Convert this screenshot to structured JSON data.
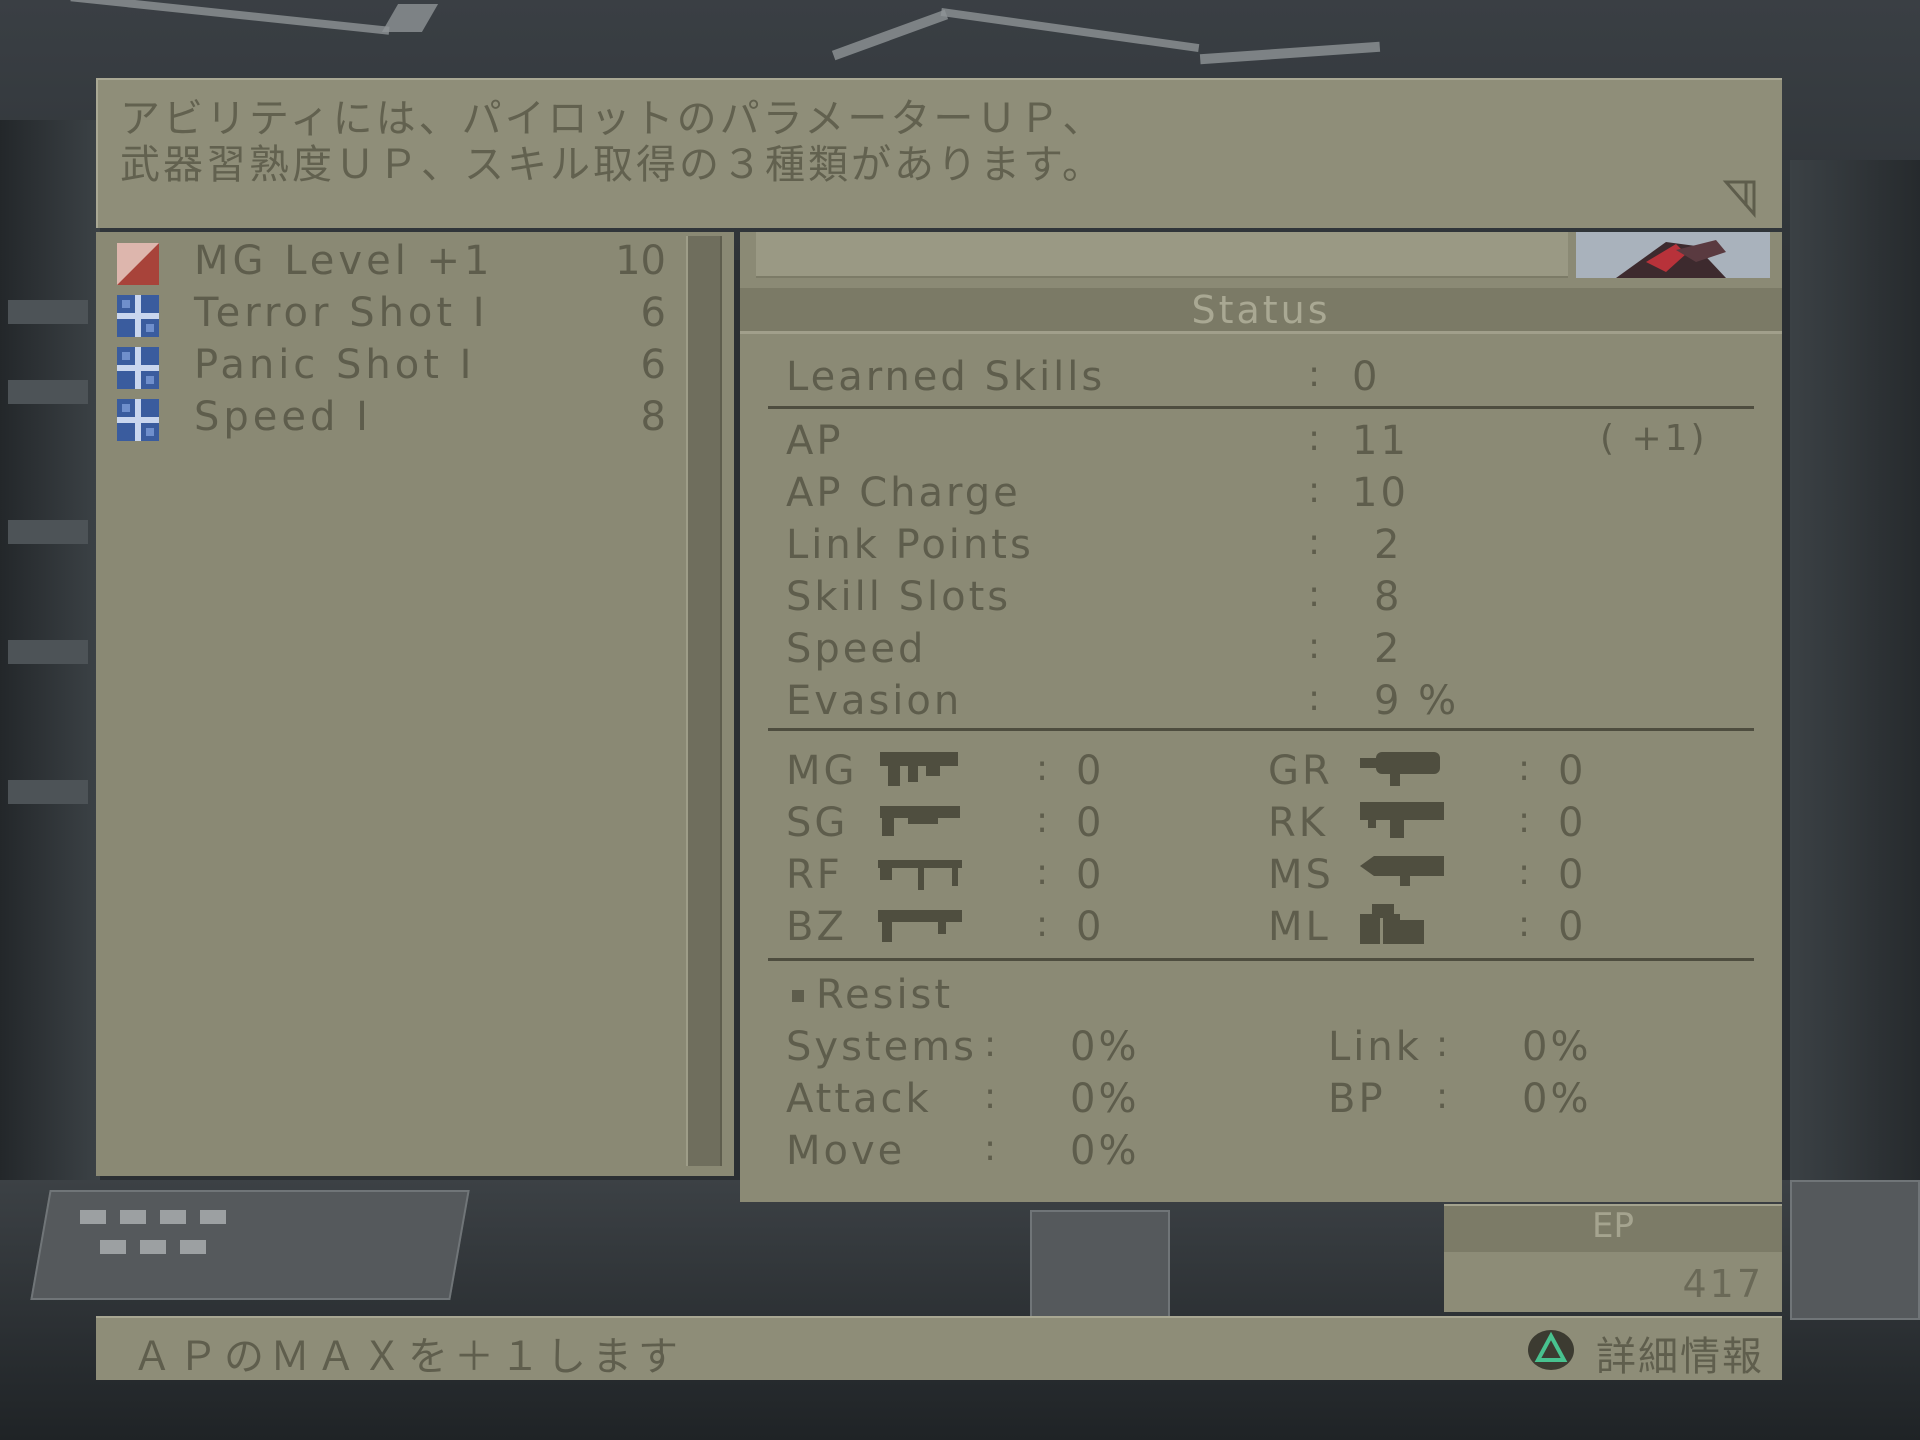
{
  "message": {
    "line1": "アビリティには、パイロットのパラメーターＵＰ、",
    "line2": "武器習熟度ＵＰ、スキル取得の３種類があります。"
  },
  "abilities": [
    {
      "name": "MG Level +1",
      "cost": "10",
      "icon": "weapon-level-icon"
    },
    {
      "name": "Terror Shot I",
      "cost": "6",
      "icon": "skill-icon"
    },
    {
      "name": "Panic Shot I",
      "cost": "6",
      "icon": "skill-icon"
    },
    {
      "name": "Speed I",
      "cost": "8",
      "icon": "skill-icon"
    }
  ],
  "status": {
    "title": "Status",
    "learned_skills": {
      "label": "Learned Skills",
      "value": "0"
    },
    "stats": [
      {
        "label": "AP",
        "value": "11",
        "extra": "( +1)"
      },
      {
        "label": "AP Charge",
        "value": "10",
        "extra": ""
      },
      {
        "label": "Link Points",
        "value": "2",
        "extra": ""
      },
      {
        "label": "Skill Slots",
        "value": "8",
        "extra": ""
      },
      {
        "label": "Speed",
        "value": "2",
        "extra": ""
      },
      {
        "label": "Evasion",
        "value": "9 %",
        "extra": ""
      }
    ],
    "weapons_left": [
      {
        "label": "MG",
        "value": "0",
        "icon": "machine-gun-icon"
      },
      {
        "label": "SG",
        "value": "0",
        "icon": "shotgun-icon"
      },
      {
        "label": "RF",
        "value": "0",
        "icon": "rifle-icon"
      },
      {
        "label": "BZ",
        "value": "0",
        "icon": "bazooka-icon"
      }
    ],
    "weapons_right": [
      {
        "label": "GR",
        "value": "0",
        "icon": "grenade-launcher-icon"
      },
      {
        "label": "RK",
        "value": "0",
        "icon": "rocket-icon"
      },
      {
        "label": "MS",
        "value": "0",
        "icon": "missile-icon"
      },
      {
        "label": "ML",
        "value": "0",
        "icon": "missile-launcher-icon"
      }
    ],
    "resist": {
      "title": "Resist",
      "left": [
        {
          "label": "Systems",
          "value": "0%"
        },
        {
          "label": "Attack",
          "value": "0%"
        },
        {
          "label": "Move",
          "value": "0%"
        }
      ],
      "right": [
        {
          "label": "Link",
          "value": "0%"
        },
        {
          "label": "BP",
          "value": "0%"
        }
      ]
    }
  },
  "ep": {
    "label": "EP",
    "value": "417"
  },
  "help": {
    "description": "ＡＰのＭＡＸを＋１します",
    "detail_label": "詳細情報"
  },
  "colors": {
    "panel": "#8e8d78",
    "text": "#5e5d4c",
    "header": "#7b7a66"
  }
}
